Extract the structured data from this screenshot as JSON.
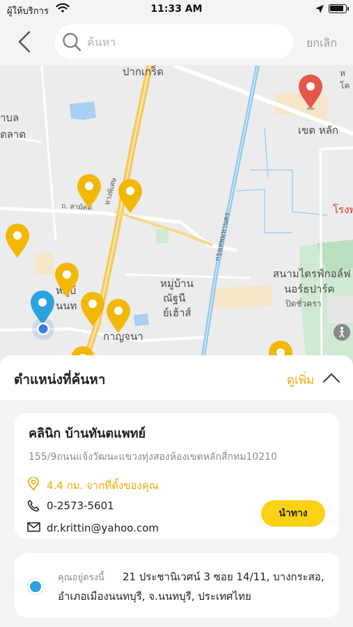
{
  "status_bar": {
    "carrier": "ผู้ให้บริการ",
    "time": "11:33 AM"
  },
  "search": {
    "placeholder": "ค้นหา",
    "cancel_label": "ยกเลิก"
  },
  "map": {
    "labels": {
      "pak_kret": "ปากเกร็ด",
      "top_right": "ห",
      "top_right2": "โค",
      "tambon": "าบล",
      "talat": "ตลาด",
      "khet_lak": "เขต หลัก",
      "rong": "โรงพ",
      "road_samakkhi": "ถ. สามัคคี",
      "tang_duan": "ทางพิเศษ",
      "chaeng": "กรุงเทพมหานคร",
      "muban1_a": "หมู่บ้",
      "muban1_b": "นนท",
      "muban2_a": "หมู่บ้าน",
      "muban2_b": "ณัฐนี",
      "muban2_c": "ย์เฮ้าส์",
      "golf_a": "สนามไดรฟ์กอล์ฟ",
      "golf_b": "นอร์ธปาร์ค",
      "golf_c": "ปิดชั่วครา",
      "kanchana": "กาญจนา"
    },
    "colors": {
      "pin_yellow": "#f2b807",
      "pin_red": "#e5574b",
      "user_blue": "#2ba4dc",
      "road_yellow": "#f5c85a",
      "road_blue": "#8ec8ee"
    }
  },
  "sheet": {
    "title": "ตำแหน่งที่ค้นหา",
    "see_more": "ดูเพิ่ม"
  },
  "place": {
    "name": "คลินิก บ้านทันตแพทย์",
    "address": "155/9ถนนแจ้งวัฒนะแขวงทุ่งสองห้องเขตหลักสี่กทม10210",
    "distance": "4.4 กม. จากที่ตั้งของคุณ",
    "phone": "0-2573-5601",
    "email": "dr.krittin@yahoo.com",
    "navigate_label": "นำทาง"
  },
  "current_location": {
    "label": "คุณอยู่ตรงนี้",
    "line1": "21 ประชานิเวศน์ 3 ซอย 14/11, บางกระสอ,",
    "line2": "อำเภอเมืองนนทบุรี, จ.นนทบุรี, ประเทศไทย"
  }
}
